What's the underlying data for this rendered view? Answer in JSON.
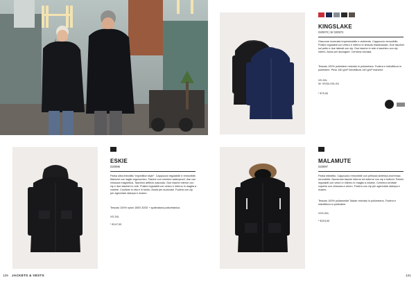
{
  "colors": {
    "card_bg": "#efece9",
    "kingslake_swatches": [
      "#c62f3a",
      "#1c2a4f",
      "#8a8f93",
      "#2a2a2a",
      "#5a5048"
    ],
    "eskie_swatches": [
      "#1f1f1f"
    ],
    "malamute_swatches": [
      "#1f1f1f"
    ]
  },
  "kingslake": {
    "swatch_labels": [
      "",
      "",
      "",
      "",
      ""
    ],
    "title": "KINGSLAKE",
    "code": "020970 | W 020972",
    "description": "Giaccone invernale impermeabile e antivento. Cappuccio removibile. Polsini regolabili con velcro e interno in tessuto elasticizzato. Due taschini sul petto e due laterali con zip. Due tasche in rete e taschino con zip interni. Ascia per asciugare. Cerniera riciclata.",
    "fabric": "Tessuto 100% poliestere resinato in poliuretano. Fodera e imbottitura in poliestere. Peso 160 g/m² imbottitura 140 g/m² maniche",
    "sizes": "XS-3XL",
    "sizes_w": "W: XS/34-XXL/44",
    "price": "* €79,00"
  },
  "eskie": {
    "title": "ESKIE",
    "code": "020996",
    "description": "Parka ultra imbottito \"expedition style\". Cappuccio regolabile e removibile. Maniche con taglio ergonomico. Tasche con cerniere waterproof, due con chiusura magnetica. Taschino artificio nascosto. Due tasche interne con zip e due taschini in rete. Polsini regolabili con velcro e interno in maglia a costine. Coulisse in vita e in fondo. Asola per auricolari. Fodera con zip per agevolare stampa e ricamo.",
    "fabric": "Tessuto 100% nylon 150D 320D + spalmatura poliuretanica",
    "sizes": "XS-3XL",
    "price": "* €147,00"
  },
  "malamute": {
    "title": "MALAMUTE",
    "code": "020997",
    "description": "Parka imbottito. Cappuccio removibile con pelliccia sintetica anch'essa removibile. Numerose tasche interne ed esterne con zip e bottoni. Polsini regolabili con velcro e interno in maglia a costine. Cerniera centrale coperta con chiusura a velcro. Fodera con zip per agevolare stampa e ricamo.",
    "fabric": "Tessuto 100% poliammide Taslan resinato in poliuretano. Fodera e imbottitura in poliestere.",
    "sizes": "XXS-3XL",
    "price": "* €215,00"
  },
  "footer": {
    "left_page": "129",
    "section": "JACKETS & VESTS",
    "right_page": "131"
  }
}
